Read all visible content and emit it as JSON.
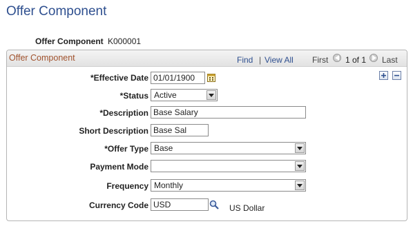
{
  "page": {
    "title": "Offer Component"
  },
  "key": {
    "label": "Offer Component",
    "value": "K000001"
  },
  "group": {
    "title": "Offer Component",
    "find": "Find",
    "separator": "|",
    "view_all": "View All",
    "first": "First",
    "range": "1 of 1",
    "last": "Last"
  },
  "form": {
    "effective_date": {
      "label": "*Effective Date",
      "value": "01/01/1900"
    },
    "status": {
      "label": "*Status",
      "value": "Active"
    },
    "description": {
      "label": "*Description",
      "value": "Base Salary"
    },
    "short_description": {
      "label": "Short Description",
      "value": "Base Sal"
    },
    "offer_type": {
      "label": "*Offer Type",
      "value": "Base"
    },
    "payment_mode": {
      "label": "Payment Mode",
      "value": ""
    },
    "frequency": {
      "label": "Frequency",
      "value": "Monthly"
    },
    "currency_code": {
      "label": "Currency Code",
      "value": "USD",
      "description": "US Dollar"
    }
  },
  "colors": {
    "title": "#2e4f8f",
    "group_title": "#a0522d",
    "link": "#2e4f8f"
  }
}
